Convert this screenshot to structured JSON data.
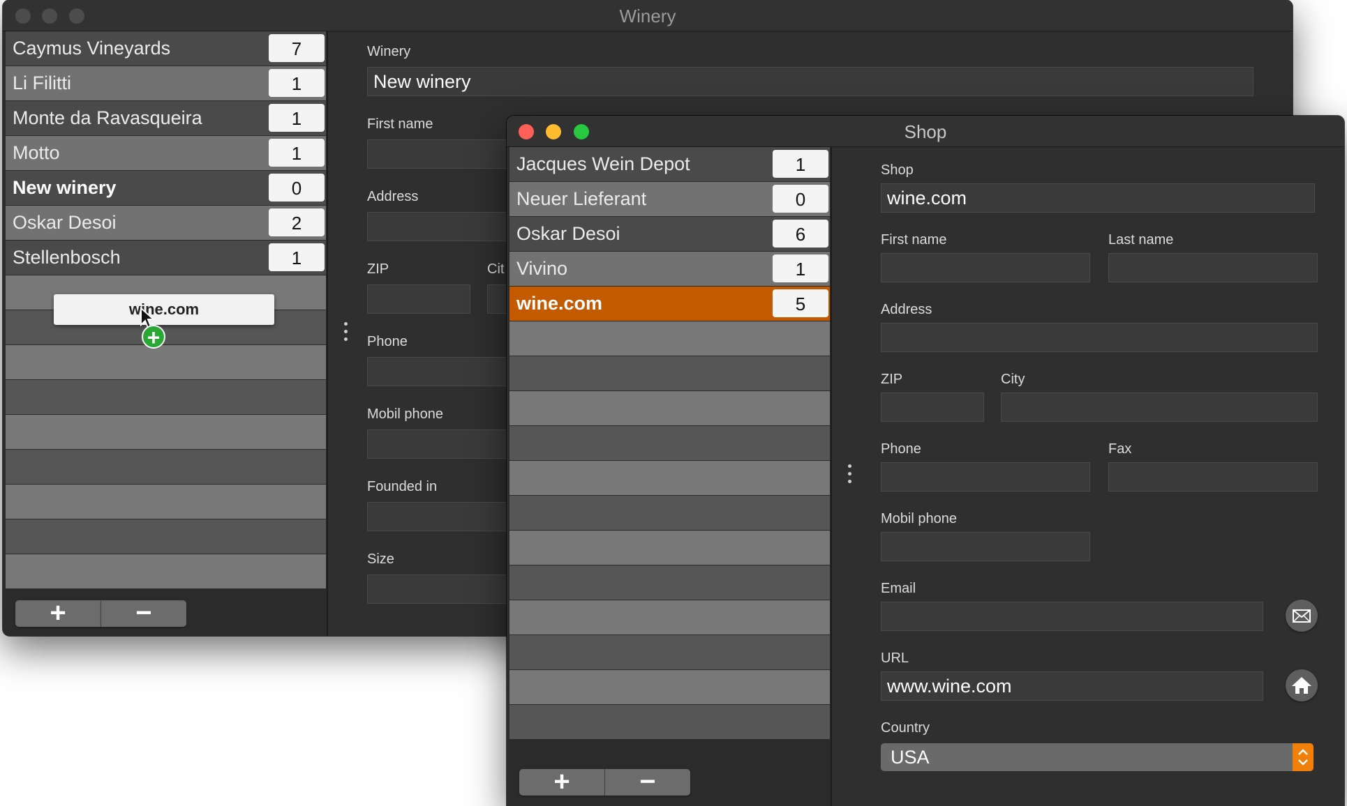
{
  "winery_window": {
    "title": "Winery",
    "list": [
      {
        "name": "Caymus Vineyards",
        "count": "7"
      },
      {
        "name": "Li Filitti",
        "count": "1"
      },
      {
        "name": "Monte da Ravasqueira",
        "count": "1"
      },
      {
        "name": "Motto",
        "count": "1"
      },
      {
        "name": "New winery",
        "count": "0"
      },
      {
        "name": "Oskar Desoi",
        "count": "2"
      },
      {
        "name": "Stellenbosch",
        "count": "1"
      }
    ],
    "selected": "New winery",
    "add_label": "+",
    "remove_label": "−",
    "drag": {
      "label": "wine.com",
      "badge": "+"
    },
    "form": {
      "winery_label": "Winery",
      "winery_value": "New winery",
      "first_name_label": "First name",
      "address_label": "Address",
      "zip_label": "ZIP",
      "city_label": "Cit",
      "phone_label": "Phone",
      "mobil_phone_label": "Mobil phone",
      "founded_label": "Founded in",
      "size_label": "Size"
    }
  },
  "shop_window": {
    "title": "Shop",
    "list": [
      {
        "name": "Jacques Wein Depot",
        "count": "1"
      },
      {
        "name": "Neuer Lieferant",
        "count": "0"
      },
      {
        "name": "Oskar Desoi",
        "count": "6"
      },
      {
        "name": "Vivino",
        "count": "1"
      },
      {
        "name": "wine.com",
        "count": "5"
      }
    ],
    "selected": "wine.com",
    "add_label": "+",
    "remove_label": "−",
    "form": {
      "shop_label": "Shop",
      "shop_value": "wine.com",
      "first_name_label": "First name",
      "last_name_label": "Last name",
      "address_label": "Address",
      "zip_label": "ZIP",
      "city_label": "City",
      "phone_label": "Phone",
      "fax_label": "Fax",
      "mobil_phone_label": "Mobil phone",
      "email_label": "Email",
      "url_label": "URL",
      "url_value": "www.wine.com",
      "country_label": "Country",
      "country_value": "USA"
    }
  },
  "colors": {
    "selection": "#c45a00",
    "close": "#fe5f57",
    "minimize": "#febc2e",
    "zoom": "#28c840",
    "popup_accent": "#f0800a"
  },
  "icons": [
    "mail-icon",
    "home-icon",
    "chevron-updown-icon",
    "mouse-cursor-icon",
    "plus-badge-icon"
  ]
}
